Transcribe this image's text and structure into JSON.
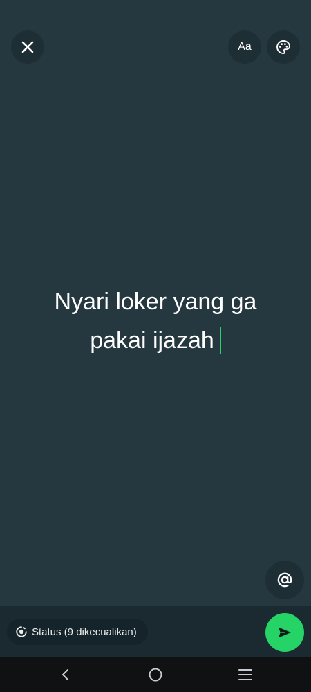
{
  "app": {
    "screen": "text-status-composer",
    "background_color": "#253840",
    "accent_color": "#25d366"
  },
  "toolbar": {
    "close_icon": "close-icon",
    "font_button_label": "Aa",
    "palette_icon": "palette-icon"
  },
  "status_text": {
    "line1": "Nyari loker yang ga",
    "line2": "pakai ijazah"
  },
  "mention": {
    "icon": "at-sign-icon",
    "symbol": "@"
  },
  "footer": {
    "audience_icon": "status-icon",
    "audience_label": "Status (9 dikecualikan)",
    "send_icon": "send-icon"
  },
  "navigation": {
    "back_icon": "back-icon",
    "home_icon": "home-icon",
    "recents_icon": "recents-icon"
  }
}
